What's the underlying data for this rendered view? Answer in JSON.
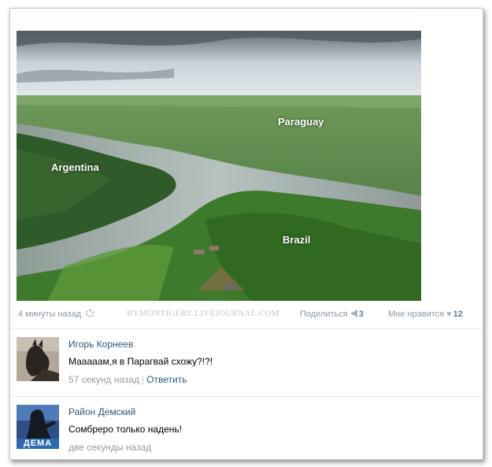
{
  "photo": {
    "labels": {
      "paraguay": "Paraguay",
      "argentina": "Argentina",
      "brazil": "Brazil"
    }
  },
  "post": {
    "time": "4 минуты назад",
    "watermark": "BYMONTIGERE.LIVEJOURNAL.COM",
    "share_label": "Поделиться",
    "share_count": "3",
    "like_label": "Мне нравится",
    "like_count": "12"
  },
  "comments": [
    {
      "author": "Игорь Корнеев",
      "text": "Мааааам,я в Парагвай схожу?!?!",
      "time": "57 секунд назад",
      "reply_label": "Ответить"
    },
    {
      "author": "Район Демский",
      "text": "Сомбреро только надень!",
      "time": "две секунды назад",
      "avatar_text": "ДЕМА"
    }
  ],
  "colors": {
    "link": "#2b587a",
    "muted": "#999999",
    "meta": "#8a98a8"
  }
}
